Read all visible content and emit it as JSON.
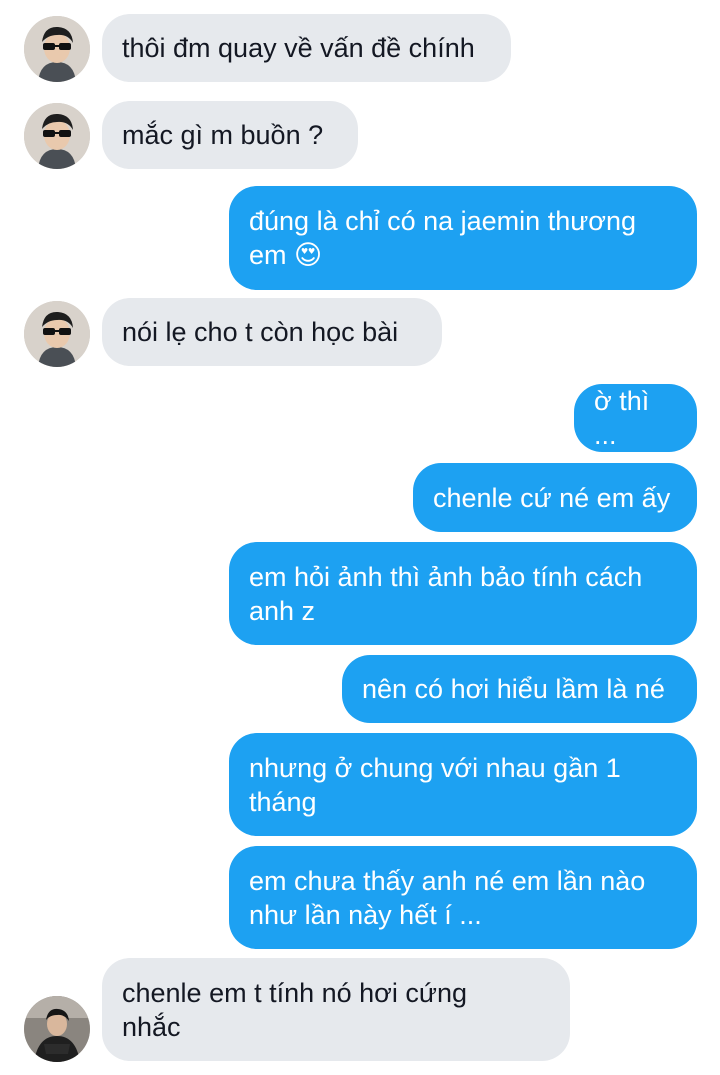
{
  "colors": {
    "incoming_bubble": "#e6e9ed",
    "outgoing_bubble": "#1da1f2",
    "incoming_text": "#141823",
    "outgoing_text": "#ffffff"
  },
  "messages": [
    {
      "direction": "incoming",
      "text": "thôi đm quay về vấn đề chính",
      "avatar": "avatar-sunglasses"
    },
    {
      "direction": "incoming",
      "text": "mắc gì m buồn ?",
      "avatar": "avatar-sunglasses"
    },
    {
      "direction": "outgoing",
      "text": "đúng là chỉ có na jaemin thương\nem 😍"
    },
    {
      "direction": "incoming",
      "text": "nói lẹ cho t còn học bài",
      "avatar": "avatar-sunglasses"
    },
    {
      "direction": "outgoing",
      "text": "ờ thì ..."
    },
    {
      "direction": "outgoing",
      "text": "chenle cứ né em ấy"
    },
    {
      "direction": "outgoing",
      "text": "em hỏi ảnh thì ảnh bảo tính cách\nanh z"
    },
    {
      "direction": "outgoing",
      "text": "nên có hơi hiểu lầm là né"
    },
    {
      "direction": "outgoing",
      "text": "nhưng ở chung với nhau gần 1\ntháng"
    },
    {
      "direction": "outgoing",
      "text": "em chưa thấy anh né em lần nào\nnhư lần này hết í ..."
    },
    {
      "direction": "incoming",
      "text": "chenle em t tính nó hơi cứng\nnhắc",
      "avatar": "avatar-dark-outfit"
    }
  ]
}
